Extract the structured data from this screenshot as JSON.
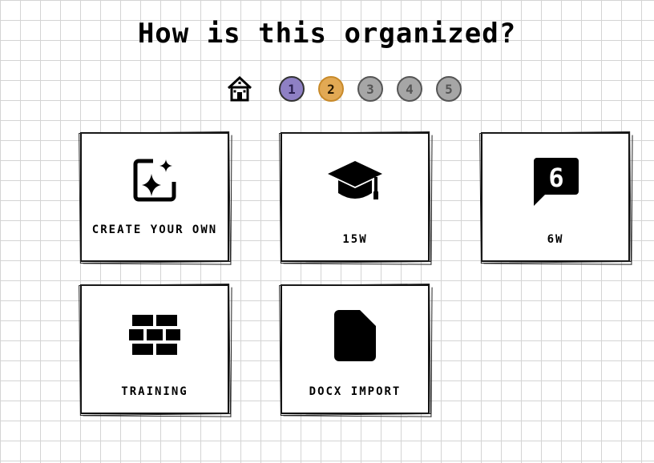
{
  "title": "How is this organized?",
  "stepper": {
    "home_icon": "home-icon",
    "steps": [
      {
        "label": "1",
        "color": "#8e80c4"
      },
      {
        "label": "2",
        "color": "#e2a954",
        "current": true
      },
      {
        "label": "3",
        "color": "#a6a6a6"
      },
      {
        "label": "4",
        "color": "#a6a6a6"
      },
      {
        "label": "5",
        "color": "#a6a6a6"
      }
    ]
  },
  "cards": [
    {
      "label": "CREATE YOUR OWN",
      "icon": "sparkle-image-icon"
    },
    {
      "label": "15W",
      "icon": "graduation-cap-icon"
    },
    {
      "label": "6W",
      "icon": "number-six-speech-bubble-icon"
    },
    {
      "label": "TRAINING",
      "icon": "brick-wall-icon"
    },
    {
      "label": "DOCX IMPORT",
      "icon": "document-icon"
    }
  ]
}
